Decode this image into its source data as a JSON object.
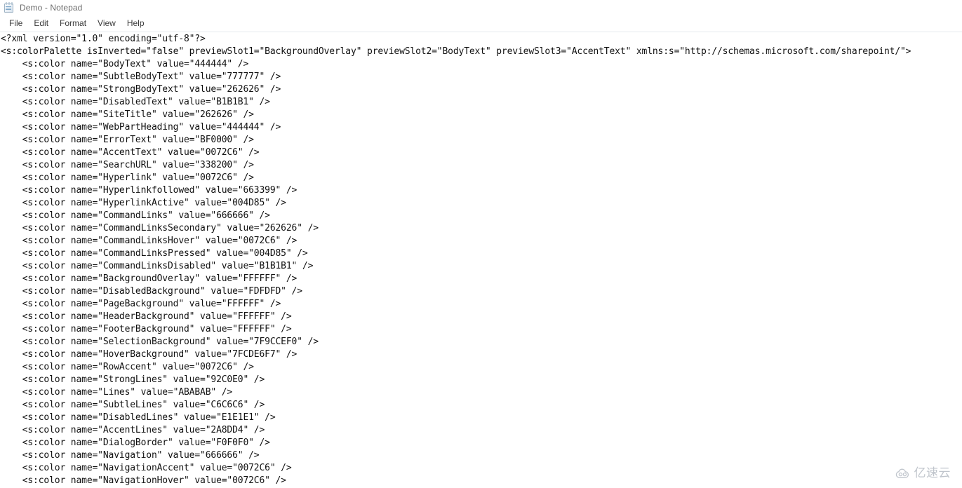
{
  "window": {
    "title": "Demo - Notepad",
    "app_icon": "notepad-icon"
  },
  "menu": {
    "items": [
      {
        "label": "File"
      },
      {
        "label": "Edit"
      },
      {
        "label": "Format"
      },
      {
        "label": "View"
      },
      {
        "label": "Help"
      }
    ]
  },
  "editor": {
    "lines": [
      "<?xml version=\"1.0\" encoding=\"utf-8\"?>",
      "<s:colorPalette isInverted=\"false\" previewSlot1=\"BackgroundOverlay\" previewSlot2=\"BodyText\" previewSlot3=\"AccentText\" xmlns:s=\"http://schemas.microsoft.com/sharepoint/\">",
      "    <s:color name=\"BodyText\" value=\"444444\" />",
      "    <s:color name=\"SubtleBodyText\" value=\"777777\" />",
      "    <s:color name=\"StrongBodyText\" value=\"262626\" />",
      "    <s:color name=\"DisabledText\" value=\"B1B1B1\" />",
      "    <s:color name=\"SiteTitle\" value=\"262626\" />",
      "    <s:color name=\"WebPartHeading\" value=\"444444\" />",
      "    <s:color name=\"ErrorText\" value=\"BF0000\" />",
      "    <s:color name=\"AccentText\" value=\"0072C6\" />",
      "    <s:color name=\"SearchURL\" value=\"338200\" />",
      "    <s:color name=\"Hyperlink\" value=\"0072C6\" />",
      "    <s:color name=\"Hyperlinkfollowed\" value=\"663399\" />",
      "    <s:color name=\"HyperlinkActive\" value=\"004D85\" />",
      "    <s:color name=\"CommandLinks\" value=\"666666\" />",
      "    <s:color name=\"CommandLinksSecondary\" value=\"262626\" />",
      "    <s:color name=\"CommandLinksHover\" value=\"0072C6\" />",
      "    <s:color name=\"CommandLinksPressed\" value=\"004D85\" />",
      "    <s:color name=\"CommandLinksDisabled\" value=\"B1B1B1\" />",
      "    <s:color name=\"BackgroundOverlay\" value=\"FFFFFF\" />",
      "    <s:color name=\"DisabledBackground\" value=\"FDFDFD\" />",
      "    <s:color name=\"PageBackground\" value=\"FFFFFF\" />",
      "    <s:color name=\"HeaderBackground\" value=\"FFFFFF\" />",
      "    <s:color name=\"FooterBackground\" value=\"FFFFFF\" />",
      "    <s:color name=\"SelectionBackground\" value=\"7F9CCEF0\" />",
      "    <s:color name=\"HoverBackground\" value=\"7FCDE6F7\" />",
      "    <s:color name=\"RowAccent\" value=\"0072C6\" />",
      "    <s:color name=\"StrongLines\" value=\"92C0E0\" />",
      "    <s:color name=\"Lines\" value=\"ABABAB\" />",
      "    <s:color name=\"SubtleLines\" value=\"C6C6C6\" />",
      "    <s:color name=\"DisabledLines\" value=\"E1E1E1\" />",
      "    <s:color name=\"AccentLines\" value=\"2A8DD4\" />",
      "    <s:color name=\"DialogBorder\" value=\"F0F0F0\" />",
      "    <s:color name=\"Navigation\" value=\"666666\" />",
      "    <s:color name=\"NavigationAccent\" value=\"0072C6\" />",
      "    <s:color name=\"NavigationHover\" value=\"0072C6\" />"
    ]
  },
  "watermark": {
    "text": "亿速云",
    "icon": "cloud-icon"
  },
  "colors": {
    "text": "#111111",
    "title": "#6d6d6d",
    "menu": "#3b3b3b",
    "separator": "#e4e9ee",
    "background": "#ffffff",
    "watermark": "#9aa3ae"
  }
}
